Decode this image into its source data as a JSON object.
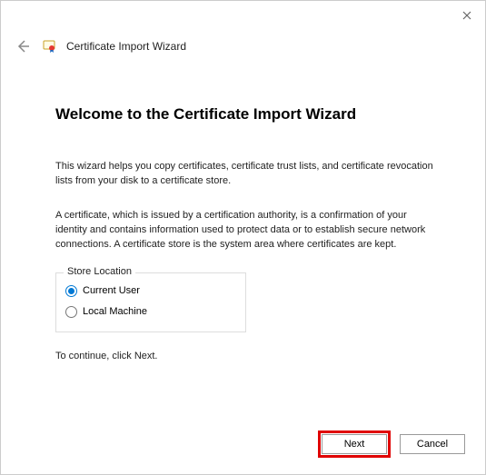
{
  "titlebar": {
    "close_tooltip": "Close"
  },
  "header": {
    "wizard_title": "Certificate Import Wizard"
  },
  "main": {
    "heading": "Welcome to the Certificate Import Wizard",
    "paragraph1": "This wizard helps you copy certificates, certificate trust lists, and certificate revocation lists from your disk to a certificate store.",
    "paragraph2": "A certificate, which is issued by a certification authority, is a confirmation of your identity and contains information used to protect data or to establish secure network connections. A certificate store is the system area where certificates are kept.",
    "store_location": {
      "legend": "Store Location",
      "option1": "Current User",
      "option2": "Local Machine",
      "selected": "Current User"
    },
    "continue_hint": "To continue, click Next."
  },
  "footer": {
    "next_label": "Next",
    "cancel_label": "Cancel"
  }
}
